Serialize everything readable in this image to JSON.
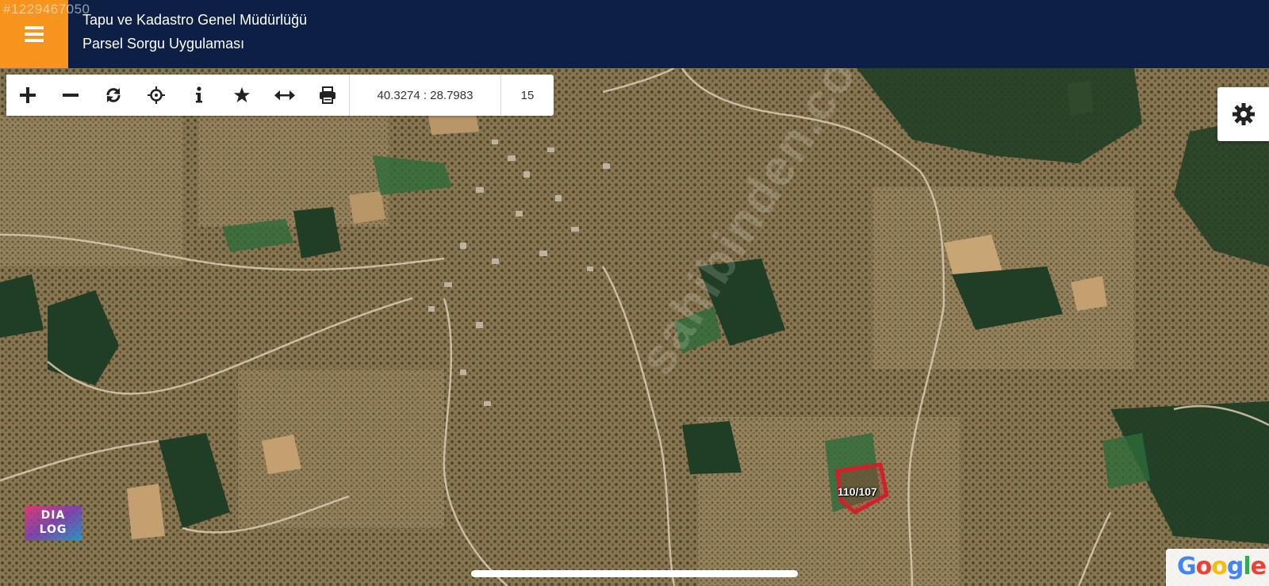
{
  "header": {
    "listing_id": "#1229467050",
    "title": "Tapu ve Kadastro Genel Müdürlüğü",
    "subtitle": "Parsel Sorgu Uygulaması",
    "background": "#0d1f45",
    "menu_color": "#f7941d",
    "menu_icon": "hamburger-icon"
  },
  "toolbar": {
    "tools": [
      {
        "name": "zoom-in",
        "icon": "plus-icon"
      },
      {
        "name": "zoom-out",
        "icon": "minus-icon"
      },
      {
        "name": "refresh",
        "icon": "refresh-icon"
      },
      {
        "name": "locate",
        "icon": "crosshair-icon"
      },
      {
        "name": "info",
        "icon": "info-icon"
      },
      {
        "name": "favorite",
        "icon": "star-icon"
      },
      {
        "name": "measure",
        "icon": "measure-arrows-icon"
      },
      {
        "name": "print",
        "icon": "print-icon"
      }
    ],
    "coordinates": "40.3274 : 28.7983",
    "zoom_level": "15"
  },
  "settings": {
    "icon": "gear-icon"
  },
  "map": {
    "parcel_label": "110/107",
    "parcel_color": "#d0212b",
    "watermark": "sahibinden.com",
    "branding_logo_line1": "DIA",
    "branding_logo_line2": "LOG",
    "attribution": "Google"
  }
}
